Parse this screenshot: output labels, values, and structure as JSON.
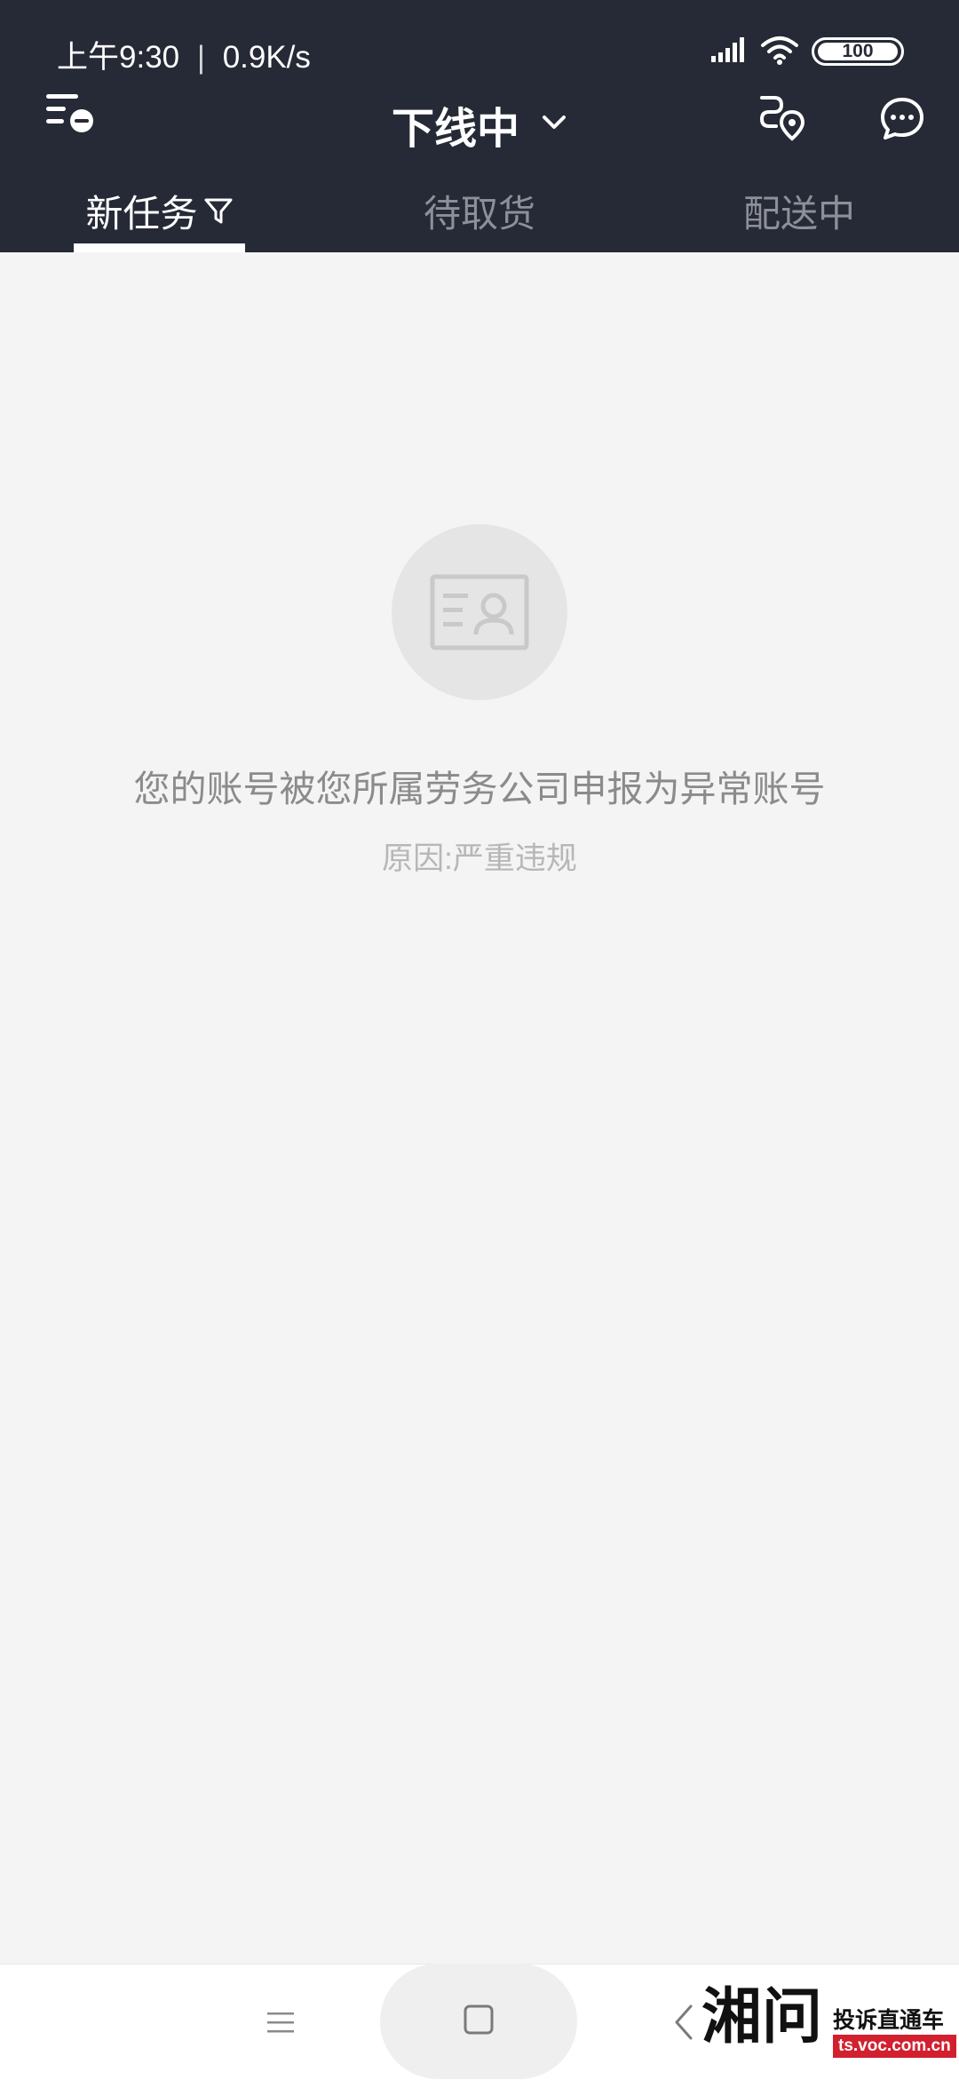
{
  "status_bar": {
    "time": "上午9:30",
    "network_speed": "0.9K/s",
    "battery": "100",
    "icons": [
      "signal-icon",
      "wifi-icon",
      "battery-icon"
    ]
  },
  "top_bar": {
    "title": "下线中",
    "left_icon": "menu-minus-icon",
    "right_icons": [
      "route-location-icon",
      "chat-icon"
    ]
  },
  "tabs": [
    {
      "label": "新任务",
      "active": true
    },
    {
      "label": "待取货",
      "active": false
    },
    {
      "label": "配送中",
      "active": false
    }
  ],
  "empty_state": {
    "icon": "id-card-icon",
    "message": "您的账号被您所属劳务公司申报为异常账号",
    "reason": "原因:严重违规"
  },
  "nav_bar": {
    "icons": [
      "menu-icon",
      "home-square-icon",
      "back-icon"
    ]
  },
  "watermark": {
    "logo_char": "湘问",
    "text": "投诉直通车",
    "url": "ts.voc.com.cn"
  },
  "colors": {
    "header_bg": "#262a36",
    "page_bg": "#f4f4f4",
    "tab_inactive": "#8d9099",
    "watermark_red": "#d2202f"
  }
}
